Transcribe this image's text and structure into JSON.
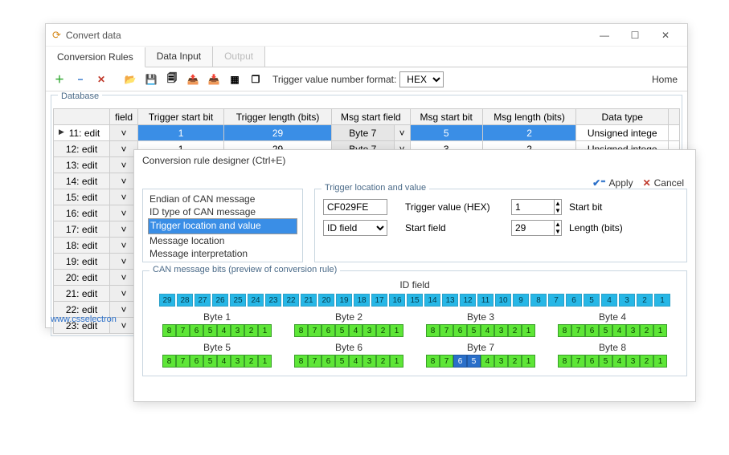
{
  "main": {
    "title": "Convert data",
    "tabs": [
      "Conversion Rules",
      "Data Input",
      "Output"
    ],
    "toolbar": {
      "trigger_fmt_label": "Trigger value number format:",
      "trigger_fmt_value": "HEX",
      "home": "Home"
    },
    "db": {
      "legend": "Database",
      "cols": [
        "field",
        "Trigger start bit",
        "Trigger length (bits)",
        "Msg start field",
        "Msg start bit",
        "Msg length (bits)",
        "Data type"
      ],
      "rows": [
        {
          "hdr": "11: edit",
          "tstart": "1",
          "tlen": "29",
          "msgfield": "Byte 7",
          "mstart": "5",
          "mlen": "2",
          "dt": "Unsigned intege",
          "sel": true
        },
        {
          "hdr": "12: edit",
          "tstart": "1",
          "tlen": "29",
          "msgfield": "Byte 7",
          "mstart": "3",
          "mlen": "2",
          "dt": "Unsigned intege"
        },
        {
          "hdr": "13: edit"
        },
        {
          "hdr": "14: edit"
        },
        {
          "hdr": "15: edit"
        },
        {
          "hdr": "16: edit"
        },
        {
          "hdr": "17: edit"
        },
        {
          "hdr": "18: edit"
        },
        {
          "hdr": "19: edit"
        },
        {
          "hdr": "20: edit"
        },
        {
          "hdr": "21: edit"
        },
        {
          "hdr": "22: edit"
        },
        {
          "hdr": "23: edit"
        }
      ]
    },
    "footer": "www.csselectron"
  },
  "dlg": {
    "title": "Conversion rule designer (Ctrl+E)",
    "apply": "Apply",
    "cancel": "Cancel",
    "nav": [
      "Endian of CAN message",
      "ID type of CAN message",
      "Trigger location and value",
      "Message location",
      "Message interpretation"
    ],
    "nav_sel": 2,
    "trig": {
      "legend": "Trigger location and value",
      "value": "CF029FE",
      "value_lbl": "Trigger value (HEX)",
      "startbit": "1",
      "startbit_lbl": "Start bit",
      "field": "ID field",
      "field_lbl": "Start field",
      "len": "29",
      "len_lbl": "Length (bits)"
    },
    "preview": {
      "legend": "CAN message bits (preview of conversion rule)",
      "idlabel": "ID field",
      "idbits": [
        "29",
        "28",
        "27",
        "26",
        "25",
        "24",
        "23",
        "22",
        "21",
        "20",
        "19",
        "18",
        "17",
        "16",
        "15",
        "14",
        "13",
        "12",
        "11",
        "10",
        "9",
        "8",
        "7",
        "6",
        "5",
        "4",
        "3",
        "2",
        "1"
      ],
      "bytes": [
        "Byte 1",
        "Byte 2",
        "Byte 3",
        "Byte 4",
        "Byte 5",
        "Byte 6",
        "Byte 7",
        "Byte 8"
      ],
      "bitlabels": [
        "8",
        "7",
        "6",
        "5",
        "4",
        "3",
        "2",
        "1"
      ],
      "hl_byte": 7,
      "hl_bits": [
        6,
        5
      ]
    }
  }
}
